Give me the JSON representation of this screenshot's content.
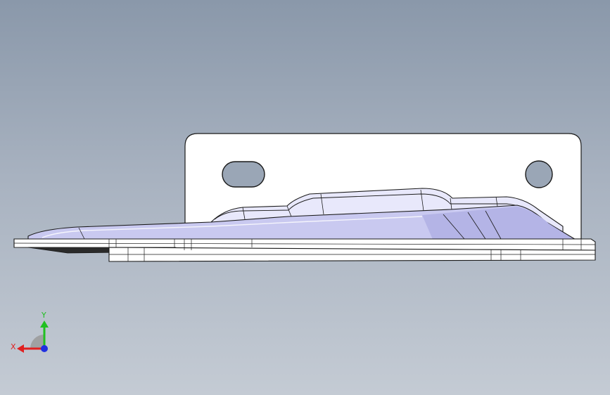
{
  "viewport": {
    "background_top": "#8a98aa",
    "background_bottom": "#c4cbd4"
  },
  "part": {
    "flange_fill": "#ffffff",
    "body_fill": "#c9c9f0",
    "shade_fill": "#b8b8ea",
    "edge_color": "#1a1a1a"
  },
  "triad": {
    "x_label": "X",
    "y_label": "Y",
    "x_color": "#e02020",
    "y_color": "#20c020",
    "z_color": "#2030e0"
  }
}
